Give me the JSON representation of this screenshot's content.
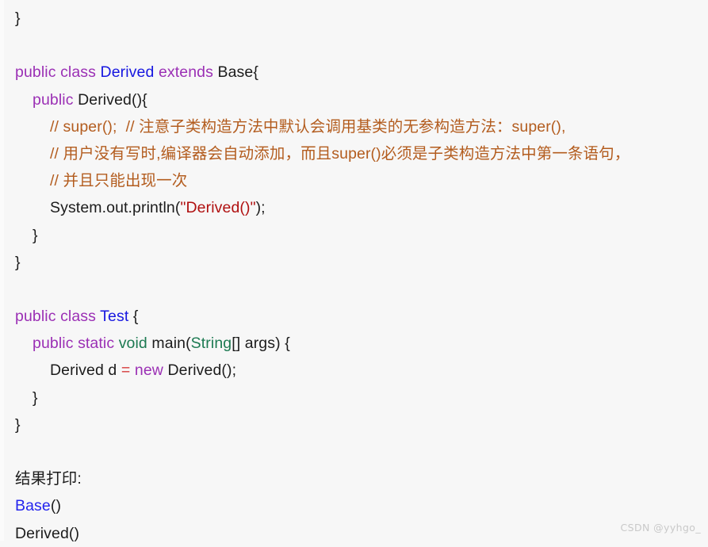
{
  "background_color": "#f7f7f7",
  "palette": {
    "keyword": "#9b30b5",
    "class_name": "#1717e0",
    "plain": "#1c1c1c",
    "comment": "#b35c1e",
    "string": "#b01010",
    "type_green": "#1d7a52",
    "operator": "#d63b3b",
    "output_blue": "#2424ee",
    "watermark": "#c9c9c9"
  },
  "watermark": "CSDN @yyhgo_",
  "lines": [
    {
      "id": "line-1-close-brace",
      "indent": 0,
      "tokens": [
        {
          "text": "}",
          "style": "plain"
        }
      ]
    },
    {
      "id": "line-2-blank",
      "indent": 0,
      "tokens": []
    },
    {
      "id": "line-3-class-derived-decl",
      "indent": 0,
      "tokens": [
        {
          "text": "public class ",
          "style": "keyword"
        },
        {
          "text": "Derived",
          "style": "class_name"
        },
        {
          "text": " extends ",
          "style": "keyword"
        },
        {
          "text": "Base{",
          "style": "plain"
        }
      ]
    },
    {
      "id": "line-4-derived-constructor",
      "indent": 1,
      "tokens": [
        {
          "text": "public ",
          "style": "keyword"
        },
        {
          "text": "Derived(){",
          "style": "plain"
        }
      ]
    },
    {
      "id": "line-5-comment-super",
      "indent": 2,
      "tokens": [
        {
          "text": "// super();  // 注意子类构造方法中默认会调用基类的无参构造方法：super(),",
          "style": "comment"
        }
      ]
    },
    {
      "id": "line-6-comment-auto-add",
      "indent": 2,
      "tokens": [
        {
          "text": "// 用户没有写时,编译器会自动添加，而且super()必须是子类构造方法中第一条语句，",
          "style": "comment"
        }
      ]
    },
    {
      "id": "line-7-comment-only-once",
      "indent": 2,
      "tokens": [
        {
          "text": "// 并且只能出现一次",
          "style": "comment"
        }
      ]
    },
    {
      "id": "line-8-println-derived",
      "indent": 2,
      "tokens": [
        {
          "text": "System.out.println(",
          "style": "plain"
        },
        {
          "text": "\"Derived()\"",
          "style": "string"
        },
        {
          "text": ");",
          "style": "plain"
        }
      ]
    },
    {
      "id": "line-9-close-method",
      "indent": 1,
      "tokens": [
        {
          "text": "}",
          "style": "plain"
        }
      ]
    },
    {
      "id": "line-10-close-class",
      "indent": 0,
      "tokens": [
        {
          "text": "}",
          "style": "plain"
        }
      ]
    },
    {
      "id": "line-11-blank",
      "indent": 0,
      "tokens": []
    },
    {
      "id": "line-12-class-test-decl",
      "indent": 0,
      "tokens": [
        {
          "text": "public class ",
          "style": "keyword"
        },
        {
          "text": "Test",
          "style": "class_name"
        },
        {
          "text": " {",
          "style": "plain"
        }
      ]
    },
    {
      "id": "line-13-main-signature",
      "indent": 1,
      "tokens": [
        {
          "text": "public static ",
          "style": "keyword"
        },
        {
          "text": "void",
          "style": "type_green"
        },
        {
          "text": " main(",
          "style": "plain"
        },
        {
          "text": "String",
          "style": "type_green"
        },
        {
          "text": "[] args) {",
          "style": "plain"
        }
      ]
    },
    {
      "id": "line-14-new-derived",
      "indent": 2,
      "tokens": [
        {
          "text": "Derived d ",
          "style": "plain"
        },
        {
          "text": "=",
          "style": "operator"
        },
        {
          "text": " ",
          "style": "plain"
        },
        {
          "text": "new",
          "style": "keyword"
        },
        {
          "text": " Derived();",
          "style": "plain"
        }
      ]
    },
    {
      "id": "line-15-close-main",
      "indent": 1,
      "tokens": [
        {
          "text": "}",
          "style": "plain"
        }
      ]
    },
    {
      "id": "line-16-close-test",
      "indent": 0,
      "tokens": [
        {
          "text": "}",
          "style": "plain"
        }
      ]
    },
    {
      "id": "line-17-blank",
      "indent": 0,
      "tokens": []
    },
    {
      "id": "line-18-result-label",
      "indent": 0,
      "tokens": [
        {
          "text": "结果打印:",
          "style": "plain"
        }
      ]
    },
    {
      "id": "line-19-output-base",
      "indent": 0,
      "tokens": [
        {
          "text": "Base",
          "style": "output_blue"
        },
        {
          "text": "()",
          "style": "plain"
        }
      ]
    },
    {
      "id": "line-20-output-derived",
      "indent": 0,
      "tokens": [
        {
          "text": "Derived()",
          "style": "plain"
        }
      ]
    }
  ]
}
